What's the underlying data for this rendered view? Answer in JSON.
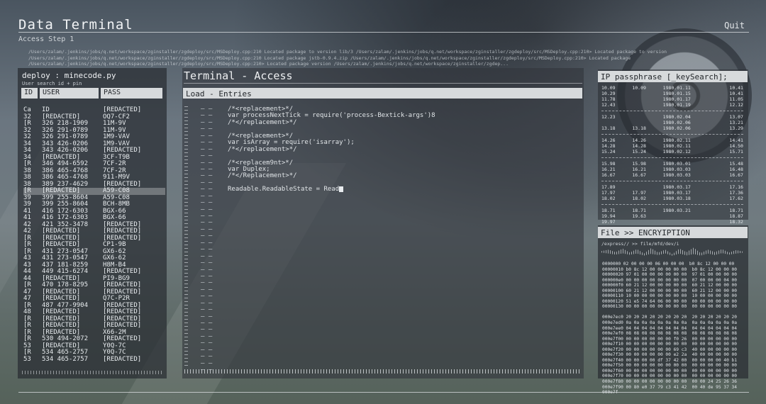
{
  "app": {
    "title": "Data Terminal",
    "subtitle": "Access Step 1",
    "quit_label": "Quit",
    "path_lines": [
      "/Users/zalam/.jenkins/jobs/q.net/workspace/zginstaller/zgdeploy/src/MSDeploy.cpp:210 Located package to version lib/3 /Users/zalam/.jenkins/jobs/q.net/workspace/zginstaller/zgdeploy/src/MSDeploy.cpp:210> Located package to version",
      "/Users/zalam/.jenkins/jobs/q.net/workspace/zginstaller/zgdeploy/src/MSDeploy.cpp:210 Located package jstb-0.9.4.zip /Users/zalam/.jenkins/jobs/q.net/workspace/zginstaller/zgdeploy/src/MSDeploy.cpp:210> Located package",
      "/Users/zalam/.jenkins/jobs/q.net/workspace/zginstaller/zgdeploy/src/MSDeploy.cpp:210> Located package version /Users/zalam/.jenkins/jobs/q.net/workspace/zginstaller/zgdep..."
    ]
  },
  "left_panel": {
    "title": "deploy : minecode.py",
    "subtitle": "User search id + pin",
    "columns": [
      "ID",
      "USER",
      "PASS"
    ],
    "rows": [
      [
        "Ca",
        "ID",
        "[REDACTED]"
      ],
      [
        "32",
        "[REDACTED]",
        "OQ7-CF2"
      ],
      [
        "[R",
        "326 218-1909",
        "11M-9V"
      ],
      [
        "32",
        "326 291-0789",
        "11M-9V"
      ],
      [
        "32",
        "326 291-0789",
        "1M9-VAV"
      ],
      [
        "34",
        "343 426-0206",
        "1M9-VAV"
      ],
      [
        "34",
        "343 426-0206",
        "[REDACTED]"
      ],
      [
        "34",
        "[REDACTED]",
        "3CF-T9B"
      ],
      [
        "[R",
        "346 494-6592",
        "7CF-2R"
      ],
      [
        "38",
        "386 465-4768",
        "7CF-2R"
      ],
      [
        "38",
        "386 465-4768",
        "911-M9V"
      ],
      [
        "38",
        "389 237-4629",
        "[REDACTED]"
      ],
      [
        "[R",
        "[REDACTED]",
        "A59-C08"
      ],
      [
        "39",
        "399 255-8604",
        "A59-C08"
      ],
      [
        "39",
        "399 255-8604",
        "BCH-8MB"
      ],
      [
        "41",
        "416 172-6303",
        "BGX-66"
      ],
      [
        "41",
        "416 172-6303",
        "BGX-66"
      ],
      [
        "42",
        "421 352-3478",
        "[REDACTED]"
      ],
      [
        "42",
        "[REDACTED]",
        "[REDACTED]"
      ],
      [
        "[R",
        "[REDACTED]",
        "[REDACTED]"
      ],
      [
        "[R",
        "[REDACTED]",
        "CP1-9B"
      ],
      [
        "[R",
        "431 273-0547",
        "GX6-62"
      ],
      [
        "43",
        "431 273-0547",
        "GX6-62"
      ],
      [
        "43",
        "437 181-8259",
        "H8M-B4"
      ],
      [
        "44",
        "449 415-6274",
        "[REDACTED]"
      ],
      [
        "44",
        "[REDACTED]",
        "PI9-BG9"
      ],
      [
        "[R",
        "470 178-8295",
        "[REDACTED]"
      ],
      [
        "47",
        "[REDACTED]",
        "[REDACTED]"
      ],
      [
        "47",
        "[REDACTED]",
        "Q7C-P2R"
      ],
      [
        "[R",
        "487 477-9904",
        "[REDACTED]"
      ],
      [
        "48",
        "[REDACTED]",
        "[REDACTED]"
      ],
      [
        "[R",
        "[REDACTED]",
        "[REDACTED]"
      ],
      [
        "[R",
        "[REDACTED]",
        "[REDACTED]"
      ],
      [
        "[R",
        "[REDACTED]",
        "X66-2M"
      ],
      [
        "[R",
        "530 494-2072",
        "[REDACTED]"
      ],
      [
        "53",
        "[REDACTED]",
        "Y0Q-7C"
      ],
      [
        "[R",
        "534 465-2757",
        "Y0Q-7C"
      ],
      [
        "53",
        "534 465-2757",
        "[REDACTED]"
      ]
    ]
  },
  "terminal": {
    "title": "Terminal - Access",
    "header": "Load - Entries",
    "lines": [
      "/*<replacement>*/",
      "var processNextTick = require('process-Bextick-args')8",
      "/*</replacement>*/",
      "",
      "/*<replacement>*/",
      "var isArray = require('isarray');",
      "/*</replacement>*/",
      "",
      "/*<replacem9nt>*/",
      "var Duplex;",
      "/*</Replacement>*/",
      "",
      "Readable.ReadableState = Read"
    ],
    "total_rows": 40
  },
  "passphrase_panel": {
    "header": "IP passphrase [_keySearch];",
    "groups": [
      [
        [
          "10.09",
          "10.09",
          "1980.01.11",
          "10.41"
        ],
        [
          "10.29",
          "",
          "1980.01.15",
          "10.41"
        ],
        [
          "11.78",
          "",
          "1980.01.17",
          "11.05"
        ],
        [
          "12.43",
          "",
          "1980.01.19",
          "12.12"
        ]
      ],
      [
        [
          "12.23",
          "",
          "1980.02.04",
          "13.07"
        ],
        [
          "",
          "",
          "1980.02.06",
          "13.21"
        ],
        [
          "13.18",
          "13.18",
          "1980.02.06",
          "13.29"
        ]
      ],
      [
        [
          "14.26",
          "14.26",
          "1980.02.11",
          "14.41"
        ],
        [
          "14.28",
          "14.28",
          "1980.02.11",
          "14.50"
        ],
        [
          "15.24",
          "15.24",
          "1980.02.12",
          "15.71"
        ]
      ],
      [
        [
          "15.98",
          "15.98",
          "1980.03.01",
          "15.48"
        ],
        [
          "16.21",
          "16.21",
          "1980.03.03",
          "16.48"
        ],
        [
          "16.67",
          "16.67",
          "1980.03.03",
          "16.67"
        ]
      ],
      [
        [
          "17.89",
          "",
          "1980.03.17",
          "17.16"
        ],
        [
          "17.97",
          "17.97",
          "1980.03.17",
          "17.36"
        ],
        [
          "18.02",
          "18.02",
          "1980.03.18",
          "17.62"
        ]
      ],
      [
        [
          "18.71",
          "18.71",
          "1980.03.21",
          "18.71"
        ],
        [
          "19.94",
          "19.63",
          "",
          "18.87"
        ],
        [
          "19.97",
          "",
          "",
          "18.32"
        ]
      ]
    ]
  },
  "file_panel": {
    "header": "File >> ENCRYIPTION",
    "path": "/express// >> file/mfd/dev/i",
    "hex_rows": [
      "0000000 02 00 00 00 06 00 00 00  b0 8c 12 00 00 00",
      "00000010 b0 8c 12 00 00 00 00 00  b0 8c 12 00 00 00",
      "00000020 97 01 00 00 00 00 00 00  97 01 00 00 00 00",
      "000000e0 00 00 00 00 00 00 00 00  07 00 00 00 04 00",
      "000000f0 60 21 12 00 00 00 00 00  60 21 12 00 00 00",
      "00000100 60 21 12 00 00 00 00 00  60 21 12 00 00 00",
      "00000110 10 00 00 00 00 00 00 00  10 00 00 00 00 00",
      "00000120 51 e5 74 64 06 00 00 00  00 00 00 00 00 00",
      "00000130 00 00 00 00 00 00 00 00  00 00 00 00 00 00",
      "",
      "000e7ec0 20 20 20 20 20 20 20 20  20 20 20 20 20 20",
      "000e7ed0 0a 0a 0a 0a 0a 0a 0a 0a  0a 0a 0a 0a 0a 0a",
      "000e7ee0 04 04 04 04 04 04 04 04  04 04 04 04 04 04",
      "000e7ef0 08 08 08 08 08 08 08 08  08 08 08 08 08 08",
      "000e7f00 00 00 00 00 00 00 f0 26  00 00 00 00 00 00",
      "000e7f10 00 00 00 00 00 00 00 00  00 00 00 00 00 00",
      "000e7f20 00 00 00 00 00 00 69 c3  40 00 00 00 00 00",
      "000e7f30 00 00 00 00 00 00 e2 2a  40 00 00 00 00 00",
      "000e7f40 00 00 00 00 df 37 42 00  00 00 00 00 40 b1",
      "000e7f50 00 00 00 00 00 00 00 00  00 00 00 00 00 00",
      "000e7f60 00 00 00 00 00 00 00 00  00 00 00 00 00 00",
      "000e7f70 00 00 00 00 00 00 00 00  00 00 00 00 00 00",
      "000e7f80 00 00 00 00 00 00 00 00  00 00 24 25 26 36",
      "000e7f90 00 80 e0 37 79 c3 41 42  00 40 de 95 37 34",
      "000e7f"
    ]
  }
}
